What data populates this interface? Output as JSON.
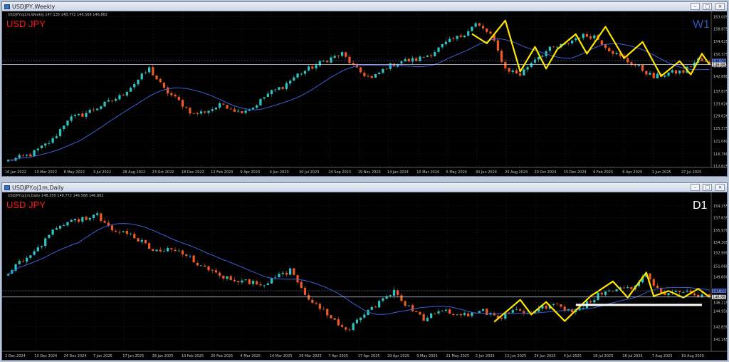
{
  "colors": {
    "bull": "#2ec4c4",
    "bear": "#f05a22",
    "ma": "#3c5fd8",
    "zigzag": "#ffe600",
    "support": "#ffffff",
    "grid": "#3b3b3b",
    "sym": "#ff1a1a"
  },
  "windows": [
    {
      "key": "weekly",
      "title": "USDJPY,Weekly",
      "info": "USDJPY.oj1m,Weekly   147.135 148.772 146.568 146.882",
      "symbol_label": "USD JPY",
      "tf_label": "W1",
      "close_label": "146.882",
      "ref_label": "148.098"
    },
    {
      "key": "daily",
      "title": "USDJPY.oj1m,Daily",
      "info": "USDJPY.oj1m,Daily   148.355 148.772 146.568 146.882",
      "symbol_label": "USD JPY",
      "tf_label": "D1",
      "close_label": "146.882",
      "ref_label": "147.724"
    }
  ],
  "chart_data": [
    {
      "type": "candlestick",
      "title": "USD JPY",
      "timeframe": "W1",
      "ylim": [
        112.2,
        163.8
      ],
      "y_ticks": [
        112.625,
        116.76,
        121.06,
        125.375,
        129.626,
        133.626,
        137.875,
        142.88,
        146.375,
        150.375,
        154.625,
        158.875,
        163.005
      ],
      "x_ticks": [
        "16 Jan 2022",
        "13 Mar 2022",
        "8 May 2022",
        "3 Jul 2022",
        "28 Aug 2022",
        "23 Oct 2022",
        "18 Dec 2022",
        "12 Feb 2023",
        "9 Apr 2023",
        "4 Jun 2023",
        "30 Jul 2023",
        "24 Sep 2023",
        "19 Nov 2023",
        "14 Jan 2024",
        "10 Mar 2024",
        "5 May 2024",
        "30 Jun 2024",
        "25 Aug 2024",
        "20 Oct 2024",
        "15 Dec 2024",
        "9 Feb 2025",
        "6 Apr 2025",
        "1 Jun 2025",
        "27 Jul 2025"
      ],
      "candle_count": 190,
      "close_price": 146.882,
      "ref_price": 148.098,
      "path": [
        [
          0,
          114.5
        ],
        [
          6,
          116.5
        ],
        [
          12,
          121.5
        ],
        [
          16,
          128.5
        ],
        [
          20,
          130.0
        ],
        [
          25,
          133.0
        ],
        [
          30,
          136.0
        ],
        [
          34,
          140.5
        ],
        [
          38,
          145.5
        ],
        [
          42,
          138.5
        ],
        [
          46,
          134.5
        ],
        [
          50,
          130.0
        ],
        [
          54,
          131.5
        ],
        [
          58,
          133.5
        ],
        [
          62,
          131.0
        ],
        [
          66,
          132.5
        ],
        [
          70,
          137.0
        ],
        [
          74,
          139.5
        ],
        [
          78,
          143.5
        ],
        [
          82,
          146.0
        ],
        [
          86,
          148.5
        ],
        [
          90,
          150.5
        ],
        [
          94,
          145.0
        ],
        [
          98,
          142.0
        ],
        [
          102,
          146.0
        ],
        [
          106,
          148.0
        ],
        [
          110,
          148.5
        ],
        [
          114,
          150.5
        ],
        [
          118,
          154.0
        ],
        [
          122,
          156.5
        ],
        [
          126,
          160.5
        ],
        [
          130,
          157.0
        ],
        [
          134,
          145.5
        ],
        [
          138,
          143.5
        ],
        [
          142,
          149.0
        ],
        [
          146,
          152.0
        ],
        [
          150,
          153.5
        ],
        [
          154,
          156.5
        ],
        [
          158,
          156.5
        ],
        [
          162,
          152.0
        ],
        [
          166,
          148.5
        ],
        [
          170,
          146.0
        ],
        [
          174,
          142.5
        ],
        [
          178,
          144.0
        ],
        [
          182,
          144.5
        ],
        [
          186,
          148.5
        ],
        [
          189,
          146.9
        ]
      ],
      "ma_period": 20,
      "zigzag": [
        [
          125,
          157.2
        ],
        [
          129,
          154.0
        ],
        [
          134,
          161.7
        ],
        [
          138,
          144.5
        ],
        [
          142,
          152.8
        ],
        [
          145,
          145.5
        ],
        [
          148,
          152.0
        ],
        [
          153,
          157.1
        ],
        [
          156,
          150.5
        ],
        [
          161,
          159.6
        ],
        [
          166,
          149.0
        ],
        [
          171,
          154.5
        ],
        [
          176,
          143.0
        ],
        [
          181,
          148.0
        ],
        [
          184,
          143.5
        ],
        [
          187,
          150.5
        ],
        [
          189,
          146.9
        ]
      ]
    },
    {
      "type": "candlestick",
      "title": "USD JPY",
      "timeframe": "D1",
      "ylim": [
        139.5,
        160.7
      ],
      "y_ticks": [
        141.165,
        142.83,
        144.95,
        146.115,
        147.78,
        149.6,
        151.06,
        152.9,
        154.305,
        155.97,
        157.635,
        159.255
      ],
      "x_ticks": [
        "2 Dec 2024",
        "13 Dec 2024",
        "24 Dec 2024",
        "7 Jan 2025",
        "17 Jan 2025",
        "28 Jan 2025",
        "10 Feb 2025",
        "20 Feb 2025",
        "4 Mar 2025",
        "14 Mar 2025",
        "26 Mar 2025",
        "7 Apr 2025",
        "17 Apr 2025",
        "29 Apr 2025",
        "9 May 2025",
        "21 May 2025",
        "2 Jun 2025",
        "12 Jun 2025",
        "24 Jun 2025",
        "4 Jul 2025",
        "16 Jul 2025",
        "28 Jul 2025",
        "7 Aug 2025",
        "19 Aug 2025"
      ],
      "candle_count": 190,
      "close_price": 146.882,
      "ref_price": 147.724,
      "path": [
        [
          0,
          150.2
        ],
        [
          4,
          152.0
        ],
        [
          8,
          153.5
        ],
        [
          12,
          156.0
        ],
        [
          16,
          157.0
        ],
        [
          20,
          157.5
        ],
        [
          24,
          158.0
        ],
        [
          28,
          156.0
        ],
        [
          32,
          155.5
        ],
        [
          36,
          154.5
        ],
        [
          40,
          153.0
        ],
        [
          44,
          153.5
        ],
        [
          48,
          152.5
        ],
        [
          52,
          151.0
        ],
        [
          56,
          150.0
        ],
        [
          60,
          149.5
        ],
        [
          64,
          149.0
        ],
        [
          68,
          148.5
        ],
        [
          72,
          149.5
        ],
        [
          76,
          150.5
        ],
        [
          80,
          147.0
        ],
        [
          84,
          145.5
        ],
        [
          88,
          143.5
        ],
        [
          92,
          142.5
        ],
        [
          96,
          144.5
        ],
        [
          100,
          146.0
        ],
        [
          104,
          147.5
        ],
        [
          108,
          145.5
        ],
        [
          112,
          144.0
        ],
        [
          116,
          145.0
        ],
        [
          120,
          144.8
        ],
        [
          124,
          144.5
        ],
        [
          128,
          145.0
        ],
        [
          132,
          144.0
        ],
        [
          136,
          145.0
        ],
        [
          140,
          144.5
        ],
        [
          144,
          145.5
        ],
        [
          148,
          146.0
        ],
        [
          152,
          144.5
        ],
        [
          156,
          146.0
        ],
        [
          160,
          147.5
        ],
        [
          164,
          148.0
        ],
        [
          168,
          147.8
        ],
        [
          172,
          150.0
        ],
        [
          176,
          147.5
        ],
        [
          180,
          147.5
        ],
        [
          184,
          147.5
        ],
        [
          189,
          146.9
        ]
      ],
      "ma_period": 20,
      "zigzag": [
        [
          131,
          143.5
        ],
        [
          138,
          146.5
        ],
        [
          141,
          144.5
        ],
        [
          145,
          146.2
        ],
        [
          150,
          143.6
        ],
        [
          157,
          147.0
        ],
        [
          163,
          149.0
        ],
        [
          167,
          146.8
        ],
        [
          172,
          150.2
        ],
        [
          174,
          147.0
        ],
        [
          178,
          147.7
        ],
        [
          182,
          146.8
        ],
        [
          186,
          148.0
        ],
        [
          189,
          146.9
        ]
      ],
      "support_line": {
        "price": 145.8,
        "x_from": 153,
        "x_to": 187
      }
    }
  ]
}
